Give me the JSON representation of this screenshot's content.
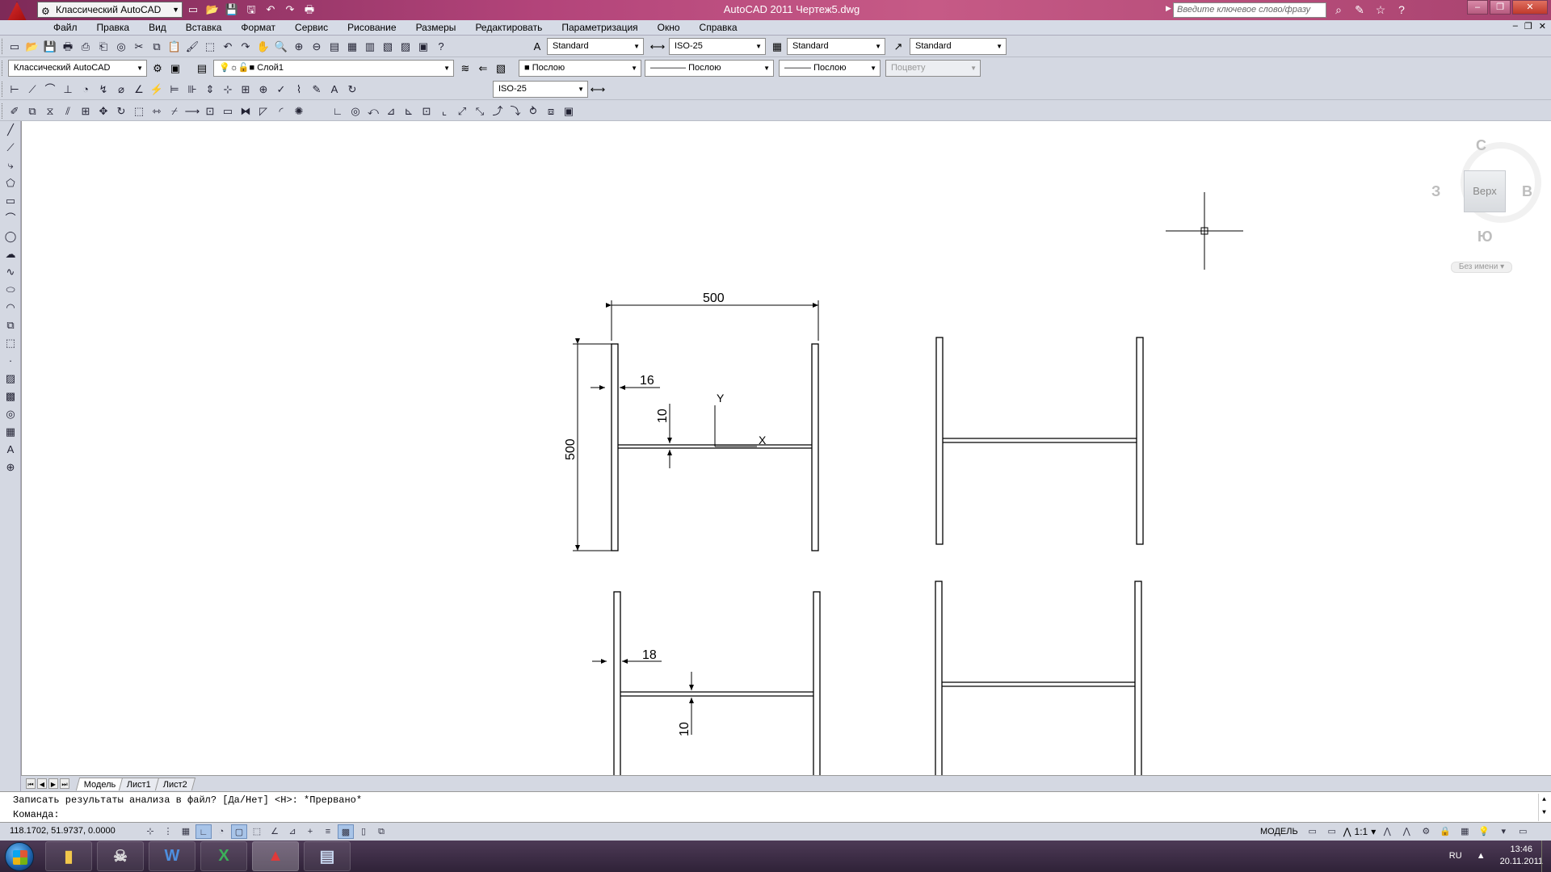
{
  "titlebar": {
    "workspace": "Классический AutoCAD",
    "title": "AutoCAD 2011  Чертеж5.dwg",
    "search_placeholder": "Введите ключевое слово/фразу",
    "qat_icons": [
      "new-icon",
      "open-icon",
      "save-icon",
      "saveas-icon",
      "undo-icon",
      "redo-icon",
      "plot-icon"
    ],
    "window_controls": [
      "minimize-icon",
      "restore-icon",
      "close-icon"
    ]
  },
  "menubar": {
    "items": [
      "Файл",
      "Правка",
      "Вид",
      "Вставка",
      "Формат",
      "Сервис",
      "Рисование",
      "Размеры",
      "Редактировать",
      "Параметризация",
      "Окно",
      "Справка"
    ]
  },
  "toolbar_styles": {
    "text_style": "Standard",
    "dim_style": "ISO-25",
    "table_style": "Standard",
    "mleader_style": "Standard"
  },
  "toolbar_layers": {
    "workspace": "Классический AutoCAD",
    "layer": "Слой1",
    "color": "Послою",
    "linetype": "Послою",
    "lineweight": "Послою",
    "plotstyle": "Поцвету"
  },
  "toolbar_dims": {
    "dim_style": "ISO-25"
  },
  "viewcube": {
    "north": "С",
    "south": "Ю",
    "west": "З",
    "east": "В",
    "face": "Верх",
    "wcs": "Без имени"
  },
  "drawing": {
    "dimensions": {
      "top_width": "500",
      "top_height": "500",
      "top_thickness": "16",
      "top_web": "10",
      "bottom_thickness": "18",
      "bottom_web": "10"
    },
    "ucs": {
      "x": "X",
      "y": "Y"
    }
  },
  "layout_tabs": [
    "Модель",
    "Лист1",
    "Лист2"
  ],
  "cmdline": {
    "history": "Записать результаты анализа в файл? [Да/Нет] <Н>: *Прервано*",
    "prompt": "Команда:"
  },
  "statusbar": {
    "coords": "118.1702, 51.9737, 0.0000",
    "model": "МОДЕЛЬ",
    "annoscale": "1:1"
  },
  "taskbar": {
    "apps": [
      "folder-app",
      "alien-app",
      "word-app",
      "excel-app",
      "autocad-app",
      "notes-app"
    ],
    "lang": "RU",
    "time": "13:46",
    "date": "20.11.2011"
  }
}
